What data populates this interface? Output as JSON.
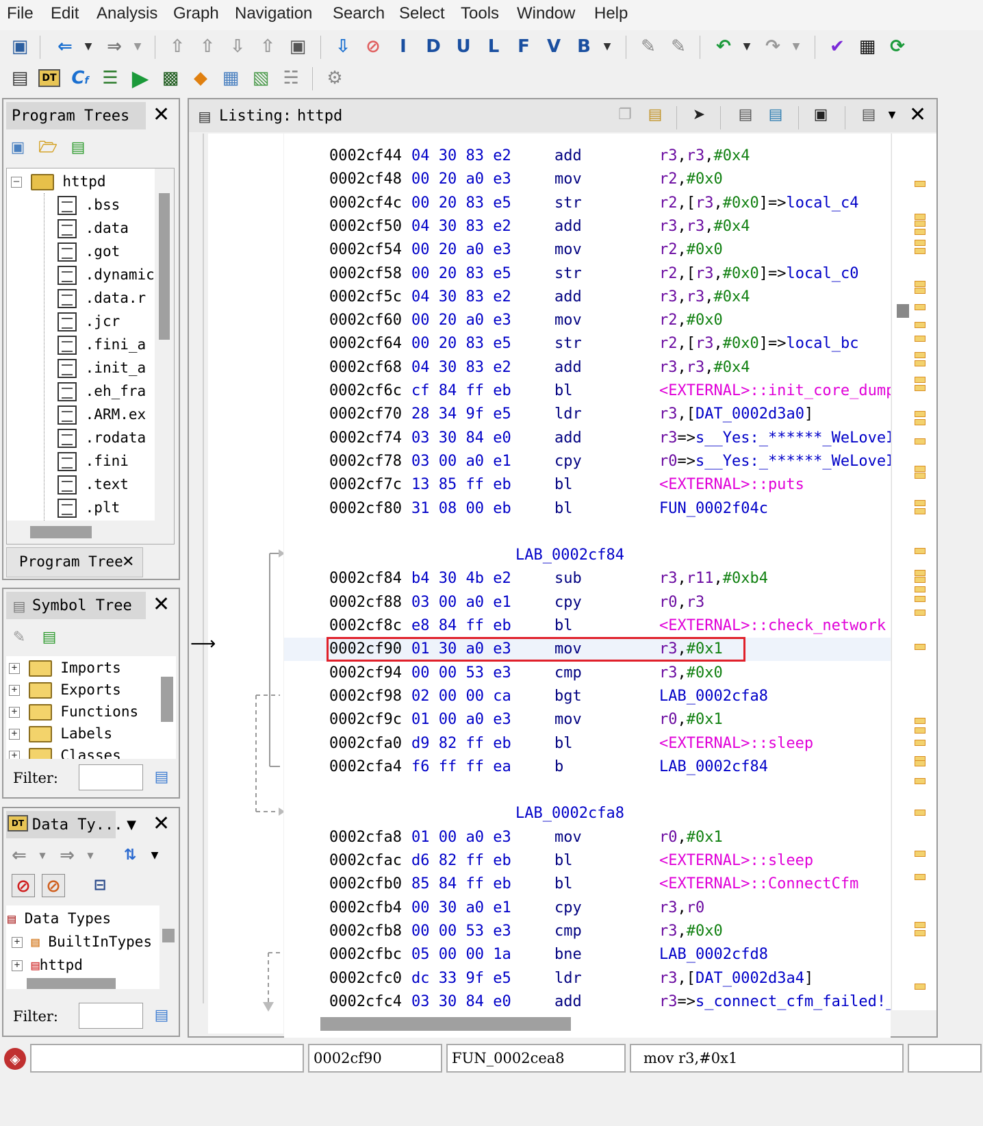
{
  "menu": [
    "File",
    "Edit",
    "Analysis",
    "Graph",
    "Navigation",
    "Search",
    "Select",
    "Tools",
    "Window",
    "Help"
  ],
  "program_trees": {
    "title": "Program Trees",
    "root": "httpd",
    "items": [
      ".bss",
      ".data",
      ".got",
      ".dynamic",
      ".data.r",
      ".jcr",
      ".fini_a",
      ".init_a",
      ".eh_fra",
      ".ARM.ex",
      ".rodata",
      ".fini",
      ".text",
      ".plt"
    ],
    "tab": "Program Tree"
  },
  "symbol_tree": {
    "title": "Symbol Tree",
    "items": [
      "Imports",
      "Exports",
      "Functions",
      "Labels",
      "Classes"
    ],
    "filter_label": "Filter:"
  },
  "data_types": {
    "title": "Data Ty...",
    "root": "Data Types",
    "items": [
      "BuiltInTypes",
      "httpd"
    ],
    "filter_label": "Filter:"
  },
  "listing": {
    "title": "Listing:",
    "program": "httpd",
    "rows": [
      {
        "type": "ins",
        "addr": "0002cf44",
        "bytes": "04 30 83 e2",
        "mn": "add",
        "op": [
          [
            "r3",
            1
          ],
          [
            ",",
            0
          ],
          [
            "r3",
            1
          ],
          [
            ",",
            0
          ],
          [
            "#0x4",
            2
          ]
        ]
      },
      {
        "type": "ins",
        "addr": "0002cf48",
        "bytes": "00 20 a0 e3",
        "mn": "mov",
        "op": [
          [
            "r2",
            1
          ],
          [
            ",",
            0
          ],
          [
            "#0x0",
            2
          ]
        ]
      },
      {
        "type": "ins",
        "addr": "0002cf4c",
        "bytes": "00 20 83 e5",
        "mn": "str",
        "op": [
          [
            "r2",
            1
          ],
          [
            ",[",
            0
          ],
          [
            "r3",
            1
          ],
          [
            ",",
            0
          ],
          [
            "#0x0",
            2
          ],
          [
            "]=>",
            0
          ],
          [
            "local_c4",
            4
          ]
        ]
      },
      {
        "type": "ins",
        "addr": "0002cf50",
        "bytes": "04 30 83 e2",
        "mn": "add",
        "op": [
          [
            "r3",
            1
          ],
          [
            ",",
            0
          ],
          [
            "r3",
            1
          ],
          [
            ",",
            0
          ],
          [
            "#0x4",
            2
          ]
        ]
      },
      {
        "type": "ins",
        "addr": "0002cf54",
        "bytes": "00 20 a0 e3",
        "mn": "mov",
        "op": [
          [
            "r2",
            1
          ],
          [
            ",",
            0
          ],
          [
            "#0x0",
            2
          ]
        ]
      },
      {
        "type": "ins",
        "addr": "0002cf58",
        "bytes": "00 20 83 e5",
        "mn": "str",
        "op": [
          [
            "r2",
            1
          ],
          [
            ",[",
            0
          ],
          [
            "r3",
            1
          ],
          [
            ",",
            0
          ],
          [
            "#0x0",
            2
          ],
          [
            "]=>",
            0
          ],
          [
            "local_c0",
            4
          ]
        ]
      },
      {
        "type": "ins",
        "addr": "0002cf5c",
        "bytes": "04 30 83 e2",
        "mn": "add",
        "op": [
          [
            "r3",
            1
          ],
          [
            ",",
            0
          ],
          [
            "r3",
            1
          ],
          [
            ",",
            0
          ],
          [
            "#0x4",
            2
          ]
        ]
      },
      {
        "type": "ins",
        "addr": "0002cf60",
        "bytes": "00 20 a0 e3",
        "mn": "mov",
        "op": [
          [
            "r2",
            1
          ],
          [
            ",",
            0
          ],
          [
            "#0x0",
            2
          ]
        ]
      },
      {
        "type": "ins",
        "addr": "0002cf64",
        "bytes": "00 20 83 e5",
        "mn": "str",
        "op": [
          [
            "r2",
            1
          ],
          [
            ",[",
            0
          ],
          [
            "r3",
            1
          ],
          [
            ",",
            0
          ],
          [
            "#0x0",
            2
          ],
          [
            "]=>",
            0
          ],
          [
            "local_bc",
            4
          ]
        ]
      },
      {
        "type": "ins",
        "addr": "0002cf68",
        "bytes": "04 30 83 e2",
        "mn": "add",
        "op": [
          [
            "r3",
            1
          ],
          [
            ",",
            0
          ],
          [
            "r3",
            1
          ],
          [
            ",",
            0
          ],
          [
            "#0x4",
            2
          ]
        ]
      },
      {
        "type": "ins",
        "addr": "0002cf6c",
        "bytes": "cf 84 ff eb",
        "mn": "bl",
        "op": [
          [
            "<EXTERNAL>::init_core_dump",
            3
          ]
        ]
      },
      {
        "type": "ins",
        "addr": "0002cf70",
        "bytes": "28 34 9f e5",
        "mn": "ldr",
        "op": [
          [
            "r3",
            1
          ],
          [
            ",[",
            0
          ],
          [
            "DAT_0002d3a0",
            4
          ],
          [
            "]",
            0
          ]
        ]
      },
      {
        "type": "ins",
        "addr": "0002cf74",
        "bytes": "03 30 84 e0",
        "mn": "add",
        "op": [
          [
            "r3",
            1
          ],
          [
            "=>",
            0
          ],
          [
            "s__Yes:_******_WeLoveI",
            4
          ]
        ]
      },
      {
        "type": "ins",
        "addr": "0002cf78",
        "bytes": "03 00 a0 e1",
        "mn": "cpy",
        "op": [
          [
            "r0",
            1
          ],
          [
            "=>",
            0
          ],
          [
            "s__Yes:_******_WeLoveI",
            4
          ]
        ]
      },
      {
        "type": "ins",
        "addr": "0002cf7c",
        "bytes": "13 85 ff eb",
        "mn": "bl",
        "op": [
          [
            "<EXTERNAL>::puts",
            3
          ]
        ]
      },
      {
        "type": "ins",
        "addr": "0002cf80",
        "bytes": "31 08 00 eb",
        "mn": "bl",
        "op": [
          [
            "FUN_0002f04c",
            4
          ]
        ]
      },
      {
        "type": "blank"
      },
      {
        "type": "label",
        "text": "LAB_0002cf84"
      },
      {
        "type": "ins",
        "addr": "0002cf84",
        "bytes": "b4 30 4b e2",
        "mn": "sub",
        "op": [
          [
            "r3",
            1
          ],
          [
            ",",
            0
          ],
          [
            "r11",
            1
          ],
          [
            ",",
            0
          ],
          [
            "#0xb4",
            2
          ]
        ]
      },
      {
        "type": "ins",
        "addr": "0002cf88",
        "bytes": "03 00 a0 e1",
        "mn": "cpy",
        "op": [
          [
            "r0",
            1
          ],
          [
            ",",
            0
          ],
          [
            "r3",
            1
          ]
        ]
      },
      {
        "type": "ins",
        "addr": "0002cf8c",
        "bytes": "e8 84 ff eb",
        "mn": "bl",
        "op": [
          [
            "<EXTERNAL>::check_network",
            3
          ]
        ]
      },
      {
        "type": "ins",
        "addr": "0002cf90",
        "bytes": "01 30 a0 e3",
        "mn": "mov",
        "op": [
          [
            "r3",
            1
          ],
          [
            ",",
            0
          ],
          [
            "#0x1",
            2
          ]
        ],
        "selected": true
      },
      {
        "type": "ins",
        "addr": "0002cf94",
        "bytes": "00 00 53 e3",
        "mn": "cmp",
        "op": [
          [
            "r3",
            1
          ],
          [
            ",",
            0
          ],
          [
            "#0x0",
            2
          ]
        ]
      },
      {
        "type": "ins",
        "addr": "0002cf98",
        "bytes": "02 00 00 ca",
        "mn": "bgt",
        "op": [
          [
            "LAB_0002cfa8",
            4
          ]
        ]
      },
      {
        "type": "ins",
        "addr": "0002cf9c",
        "bytes": "01 00 a0 e3",
        "mn": "mov",
        "op": [
          [
            "r0",
            1
          ],
          [
            ",",
            0
          ],
          [
            "#0x1",
            2
          ]
        ]
      },
      {
        "type": "ins",
        "addr": "0002cfa0",
        "bytes": "d9 82 ff eb",
        "mn": "bl",
        "op": [
          [
            "<EXTERNAL>::sleep",
            3
          ]
        ]
      },
      {
        "type": "ins",
        "addr": "0002cfa4",
        "bytes": "f6 ff ff ea",
        "mn": "b",
        "op": [
          [
            "LAB_0002cf84",
            4
          ]
        ]
      },
      {
        "type": "blank"
      },
      {
        "type": "label",
        "text": "LAB_0002cfa8"
      },
      {
        "type": "ins",
        "addr": "0002cfa8",
        "bytes": "01 00 a0 e3",
        "mn": "mov",
        "op": [
          [
            "r0",
            1
          ],
          [
            ",",
            0
          ],
          [
            "#0x1",
            2
          ]
        ]
      },
      {
        "type": "ins",
        "addr": "0002cfac",
        "bytes": "d6 82 ff eb",
        "mn": "bl",
        "op": [
          [
            "<EXTERNAL>::sleep",
            3
          ]
        ]
      },
      {
        "type": "ins",
        "addr": "0002cfb0",
        "bytes": "85 84 ff eb",
        "mn": "bl",
        "op": [
          [
            "<EXTERNAL>::ConnectCfm",
            3
          ]
        ]
      },
      {
        "type": "ins",
        "addr": "0002cfb4",
        "bytes": "00 30 a0 e1",
        "mn": "cpy",
        "op": [
          [
            "r3",
            1
          ],
          [
            ",",
            0
          ],
          [
            "r0",
            1
          ]
        ]
      },
      {
        "type": "ins",
        "addr": "0002cfb8",
        "bytes": "00 00 53 e3",
        "mn": "cmp",
        "op": [
          [
            "r3",
            1
          ],
          [
            ",",
            0
          ],
          [
            "#0x0",
            2
          ]
        ]
      },
      {
        "type": "ins",
        "addr": "0002cfbc",
        "bytes": "05 00 00 1a",
        "mn": "bne",
        "op": [
          [
            "LAB_0002cfd8",
            4
          ]
        ]
      },
      {
        "type": "ins",
        "addr": "0002cfc0",
        "bytes": "dc 33 9f e5",
        "mn": "ldr",
        "op": [
          [
            "r3",
            1
          ],
          [
            ",[",
            0
          ],
          [
            "DAT_0002d3a4",
            4
          ],
          [
            "]",
            0
          ]
        ]
      },
      {
        "type": "ins",
        "addr": "0002cfc4",
        "bytes": "03 30 84 e0",
        "mn": "add",
        "op": [
          [
            "r3",
            1
          ],
          [
            "=>",
            0
          ],
          [
            "s_connect_cfm_failed!_",
            4
          ]
        ]
      }
    ]
  },
  "status": {
    "address": "0002cf90",
    "function": "FUN_0002cea8",
    "instruction": "mov r3,#0x1"
  }
}
